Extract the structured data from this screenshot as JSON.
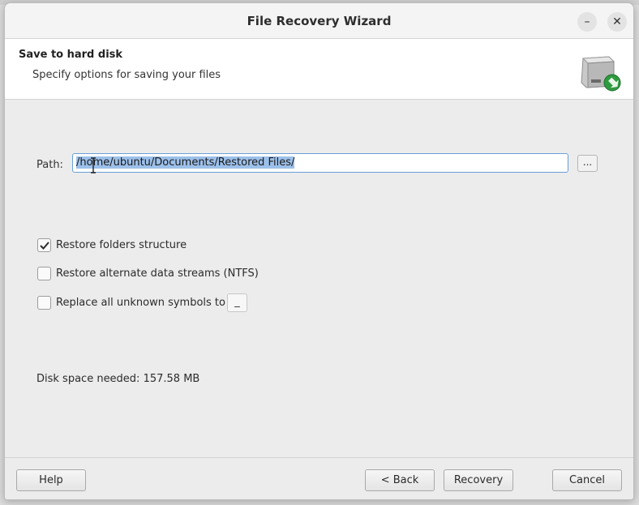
{
  "window": {
    "title": "File Recovery Wizard",
    "minimize_glyph": "–",
    "close_glyph": "✕"
  },
  "header": {
    "title": "Save to hard disk",
    "subtitle": "Specify options for saving your files",
    "icon": "hard-disk-save-icon"
  },
  "path": {
    "label": "Path:",
    "value": "/home/ubuntu/Documents/Restored Files/",
    "browse_label": "..."
  },
  "options": [
    {
      "label": "Restore folders structure",
      "checked": true
    },
    {
      "label": "Restore alternate data streams (NTFS)",
      "checked": false
    },
    {
      "label": "Replace all unknown symbols to",
      "checked": false,
      "symbol": "_"
    }
  ],
  "disk_space": "Disk space needed: 157.58 MB",
  "footer": {
    "help": "Help",
    "back": "< Back",
    "recovery": "Recovery",
    "cancel": "Cancel"
  },
  "colors": {
    "selection": "#9cc0ea",
    "focus_border": "#6a9fd8",
    "badge_green": "#2e9a3e"
  }
}
